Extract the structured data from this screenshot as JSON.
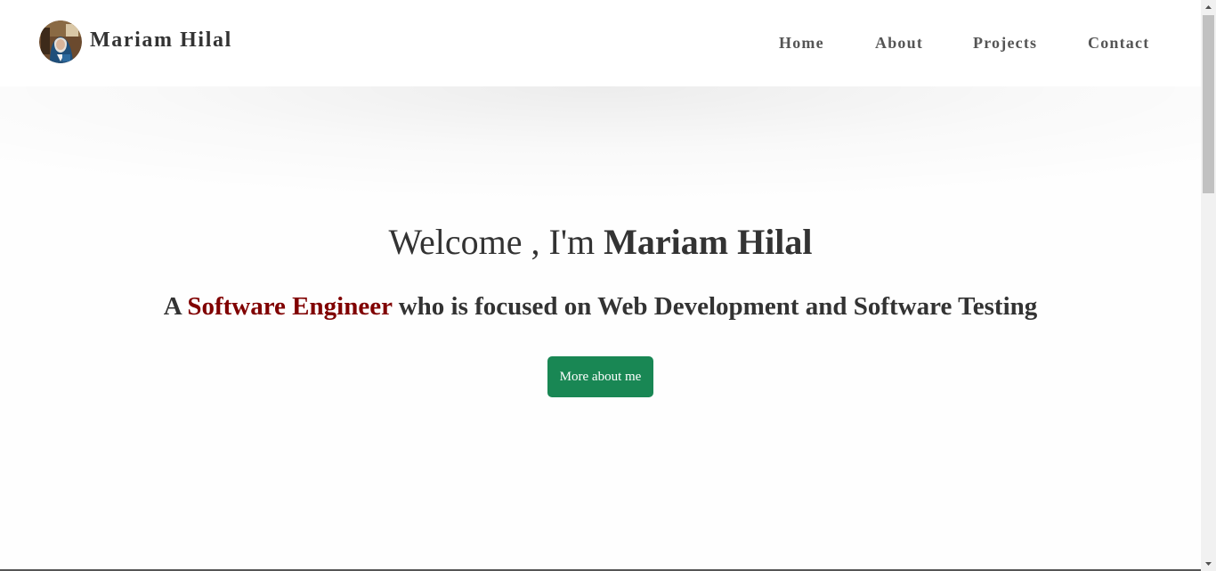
{
  "navbar": {
    "brand_name": "Mariam Hilal",
    "links": [
      {
        "label": "Home"
      },
      {
        "label": "About"
      },
      {
        "label": "Projects"
      },
      {
        "label": "Contact"
      }
    ]
  },
  "hero": {
    "title_prefix": "Welcome , I'm ",
    "title_name": "Mariam Hilal",
    "subtitle_prefix": "A ",
    "subtitle_accent": "Software Engineer",
    "subtitle_suffix": " who is focused on Web Development and Software Testing",
    "cta_label": "More about me"
  },
  "colors": {
    "accent": "#800000",
    "button": "#198754",
    "text": "#333333",
    "nav_text": "#555555"
  },
  "icons": {
    "avatar": "profile-photo",
    "scroll_up": "triangle-up-icon",
    "scroll_down": "triangle-down-icon"
  }
}
